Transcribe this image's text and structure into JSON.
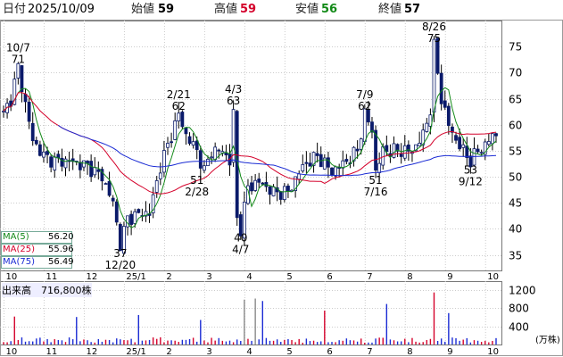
{
  "header": {
    "date_label": "日付",
    "date_value": "2025/10/09",
    "open_label": "始値",
    "open_value": "59",
    "high_label": "高値",
    "high_value": "59",
    "low_label": "安値",
    "low_value": "56",
    "close_label": "終値",
    "close_value": "57"
  },
  "ma_legend": [
    {
      "label": "MA(5)",
      "value": "56.20",
      "color": "#138a18"
    },
    {
      "label": "MA(25)",
      "value": "55.96",
      "color": "#d4002a"
    },
    {
      "label": "MA(75)",
      "value": "56.49",
      "color": "#1a2bd4"
    }
  ],
  "volume_label": "出来高　716,800株",
  "volume_unit": "(万株)",
  "chart_data": {
    "type": "candlestick",
    "price_axis": {
      "ticks": [
        35,
        40,
        45,
        50,
        55,
        60,
        65,
        70,
        75
      ],
      "range": [
        32,
        80
      ]
    },
    "volume_axis": {
      "ticks": [
        400,
        800,
        1200
      ],
      "unit": "(万株)"
    },
    "x_ticks": [
      "10",
      "11",
      "12",
      "25/1",
      "2",
      "3",
      "4",
      "5",
      "6",
      "7",
      "8",
      "9",
      "10"
    ],
    "annotations": [
      {
        "date": "10/7",
        "value": "71",
        "type": "high"
      },
      {
        "date": "12/20",
        "value": "37",
        "type": "low"
      },
      {
        "date": "2/21",
        "value": "62",
        "type": "high"
      },
      {
        "date": "2/28",
        "value": "51",
        "type": "low"
      },
      {
        "date": "4/3",
        "value": "63",
        "type": "high"
      },
      {
        "date": "4/7",
        "value": "40",
        "type": "low"
      },
      {
        "date": "7/9",
        "value": "62",
        "type": "high"
      },
      {
        "date": "7/16",
        "value": "51",
        "type": "low"
      },
      {
        "date": "8/26",
        "value": "75",
        "type": "high"
      },
      {
        "date": "9/12",
        "value": "53",
        "type": "low"
      }
    ],
    "price_anchors": [
      [
        0,
        62
      ],
      [
        2,
        65
      ],
      [
        4,
        71
      ],
      [
        6,
        64
      ],
      [
        8,
        57
      ],
      [
        11,
        54
      ],
      [
        14,
        53
      ],
      [
        18,
        53
      ],
      [
        23,
        52
      ],
      [
        27,
        50
      ],
      [
        30,
        45
      ],
      [
        32,
        37
      ],
      [
        34,
        42
      ],
      [
        38,
        43
      ],
      [
        40,
        43
      ],
      [
        43,
        52
      ],
      [
        46,
        58
      ],
      [
        48,
        62
      ],
      [
        50,
        58
      ],
      [
        53,
        55
      ],
      [
        55,
        51
      ],
      [
        57,
        55
      ],
      [
        60,
        55
      ],
      [
        62,
        53
      ],
      [
        63,
        62
      ],
      [
        64,
        42
      ],
      [
        65,
        40
      ],
      [
        67,
        48
      ],
      [
        70,
        49
      ],
      [
        74,
        47
      ],
      [
        78,
        47
      ],
      [
        82,
        52
      ],
      [
        86,
        54
      ],
      [
        90,
        51
      ],
      [
        94,
        53
      ],
      [
        97,
        55
      ],
      [
        99,
        62
      ],
      [
        101,
        59
      ],
      [
        102,
        51
      ],
      [
        104,
        55
      ],
      [
        108,
        55
      ],
      [
        112,
        55
      ],
      [
        115,
        58
      ],
      [
        117,
        63
      ],
      [
        118,
        75
      ],
      [
        120,
        65
      ],
      [
        122,
        60
      ],
      [
        124,
        57
      ],
      [
        126,
        55
      ],
      [
        128,
        53
      ],
      [
        130,
        55
      ],
      [
        132,
        56
      ],
      [
        134,
        58
      ]
    ],
    "ma75_start_index": 15
  }
}
